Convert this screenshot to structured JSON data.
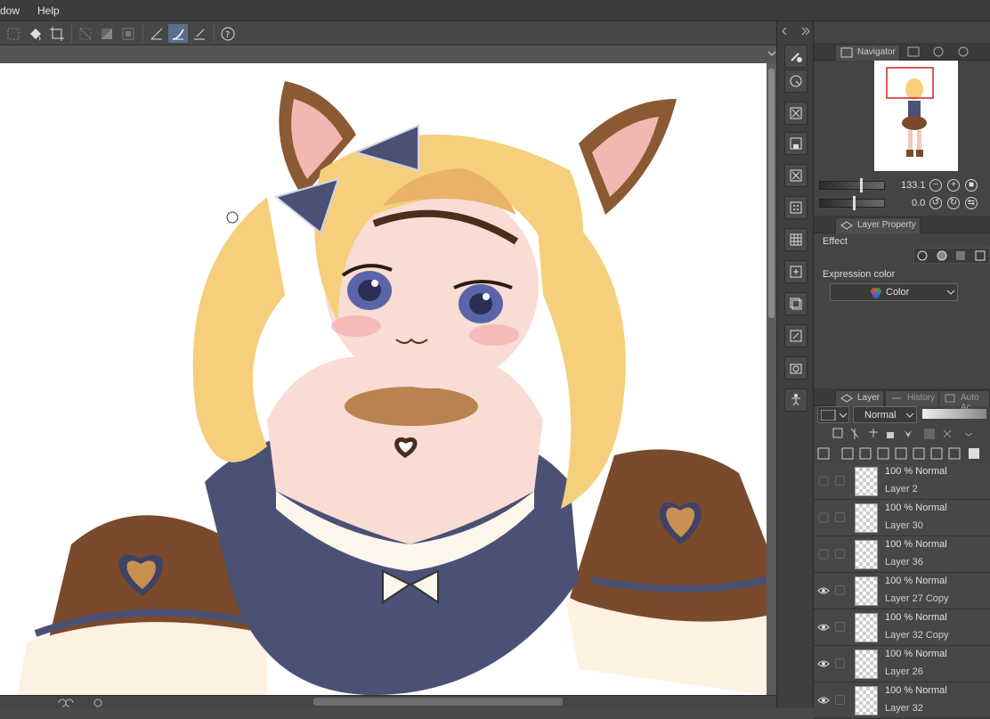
{
  "menu": {
    "window_label": "dow",
    "help_label": "Help"
  },
  "navigator": {
    "tabs": [
      "Navigator"
    ],
    "zoom_value": "133.1",
    "rotate_value": "0.0"
  },
  "layer_property": {
    "tab_label": "Layer Property",
    "effect_label": "Effect",
    "expression_color_label": "Expression color",
    "expression_color_value": "Color"
  },
  "layer_panel": {
    "tabs": [
      "Layer",
      "History",
      "Auto Ac"
    ],
    "blend_mode": "Normal",
    "layers": [
      {
        "mode": "100 % Normal",
        "name": "Layer 2",
        "visible": false
      },
      {
        "mode": "100 % Normal",
        "name": "Layer 30",
        "visible": false
      },
      {
        "mode": "100 % Normal",
        "name": "Layer 36",
        "visible": false
      },
      {
        "mode": "100 % Normal",
        "name": "Layer 27 Copy",
        "visible": true
      },
      {
        "mode": "100 % Normal",
        "name": "Layer 32 Copy",
        "visible": true
      },
      {
        "mode": "100 % Normal",
        "name": "Layer 26",
        "visible": true
      },
      {
        "mode": "100 % Normal",
        "name": "Layer 32",
        "visible": true
      }
    ]
  },
  "colors": {
    "accent": "#5a6f8e",
    "hair": "#f6cf7c",
    "ear": "#8a5a34",
    "dress": "#4b5175",
    "sleeve": "#7a4a2c",
    "skin": "#f9dcd4"
  },
  "icons": [
    "fill-bucket-icon",
    "transform-icon",
    "pen-pressure-icon",
    "help-icon",
    "visibility-eye-icon"
  ]
}
